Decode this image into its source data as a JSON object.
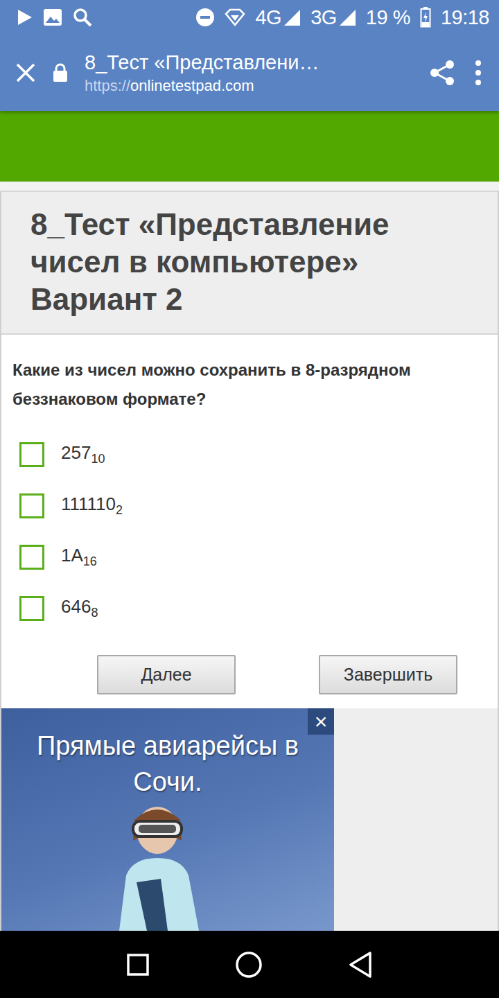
{
  "status_bar": {
    "networks": [
      "4G",
      "3G"
    ],
    "battery": "19 %",
    "time": "19:18"
  },
  "browser": {
    "title": "8_Тест «Представлени…",
    "url_scheme": "https://",
    "url_host": "onlinetestpad.com"
  },
  "test": {
    "title": "8_Тест «Представление чисел в компьютере» Вариант 2",
    "question": "Какие из чисел можно сохранить в 8-разрядном беззнаковом формате?",
    "options": [
      {
        "value": "257",
        "base": "10",
        "checked": false
      },
      {
        "value": "111110",
        "base": "2",
        "checked": false
      },
      {
        "value": "1A",
        "base": "16",
        "checked": false
      },
      {
        "value": "646",
        "base": "8",
        "checked": false
      }
    ],
    "buttons": [
      "Далее",
      "Завершить"
    ]
  },
  "ad": {
    "text": "Прямые авиарейсы в Сочи.",
    "close": "×"
  }
}
